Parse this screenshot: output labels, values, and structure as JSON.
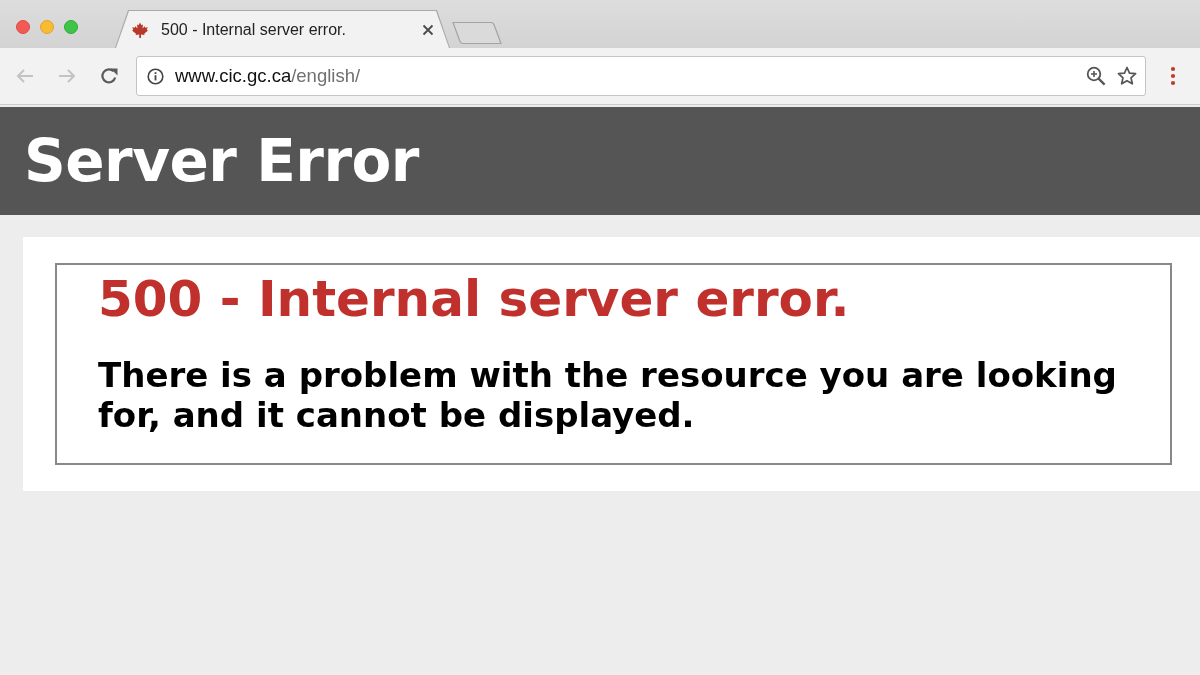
{
  "window": {
    "tabs": [
      {
        "title": "500 - Internal server error.",
        "selected": true
      }
    ]
  },
  "toolbar": {
    "nav_buttons": [
      {
        "kind": "back",
        "disabled": true
      },
      {
        "kind": "forward",
        "disabled": true
      },
      {
        "kind": "reload",
        "disabled": false
      }
    ],
    "address_bar": {
      "host": "www.cic.gc.ca",
      "path": "/english/"
    }
  },
  "page": {
    "header": "Server Error",
    "error": {
      "title": "500 - Internal server error.",
      "message": "There is a problem with the resource you are looking for, and it cannot be displayed."
    }
  }
}
